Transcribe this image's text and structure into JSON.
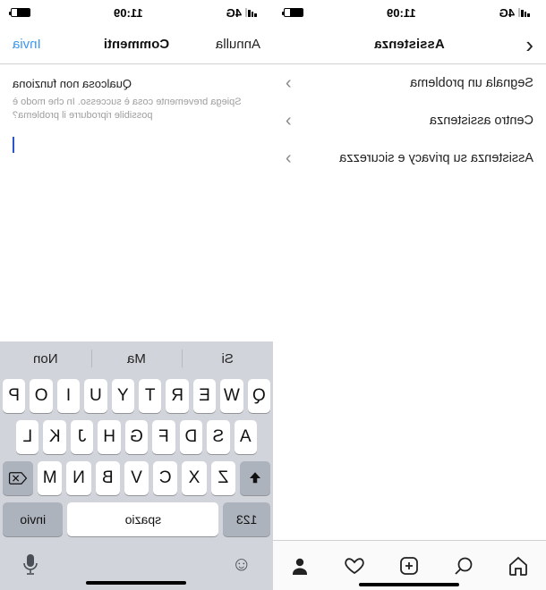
{
  "status": {
    "time": "11:09",
    "carrier": "4G"
  },
  "left": {
    "nav": {
      "title": "Assistenza"
    },
    "rows": [
      {
        "label": "Segnala un problema"
      },
      {
        "label": "Centro assistenza"
      },
      {
        "label": "Assistenza su privacy e sicurezza"
      }
    ]
  },
  "right": {
    "nav": {
      "cancel": "Annulla",
      "title": "Commenti",
      "send": "Invia"
    },
    "compose": {
      "heading": "Qualcosa non funziona",
      "placeholder": "Spiega brevemente cosa è successo. In che modo è possibile riprodurre il problema?"
    },
    "keyboard": {
      "suggestions": [
        "Si",
        "Ma",
        "Non"
      ],
      "row1": [
        "Q",
        "W",
        "E",
        "R",
        "T",
        "Y",
        "U",
        "I",
        "O",
        "P"
      ],
      "row2": [
        "A",
        "S",
        "D",
        "F",
        "G",
        "H",
        "J",
        "K",
        "L"
      ],
      "row3": [
        "Z",
        "X",
        "C",
        "V",
        "B",
        "N",
        "M"
      ],
      "num": "123",
      "space": "spazio",
      "return": "invio"
    }
  }
}
